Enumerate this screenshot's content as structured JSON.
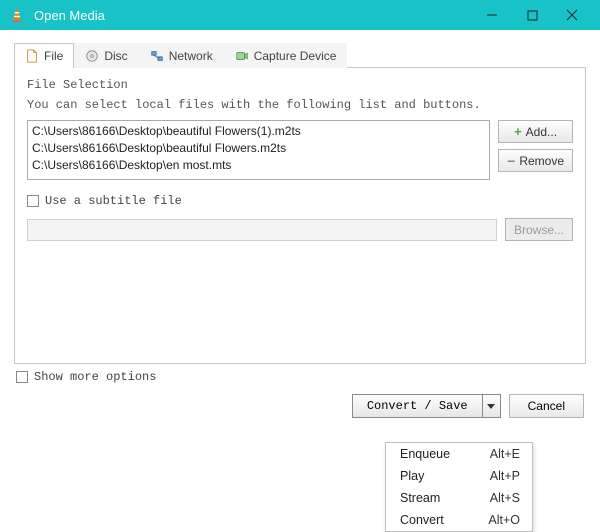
{
  "window": {
    "title": "Open Media"
  },
  "tabs": {
    "file": "File",
    "disc": "Disc",
    "network": "Network",
    "capture": "Capture Device"
  },
  "file_section": {
    "title": "File Selection",
    "hint": "You can select local files with the following list and buttons.",
    "files": [
      "C:\\Users\\86166\\Desktop\\beautiful Flowers(1).m2ts",
      "C:\\Users\\86166\\Desktop\\beautiful Flowers.m2ts",
      "C:\\Users\\86166\\Desktop\\en most.mts"
    ],
    "add_label": "Add...",
    "remove_label": "Remove"
  },
  "subtitle": {
    "use_label": "Use a subtitle file",
    "browse_label": "Browse..."
  },
  "more_options_label": "Show more options",
  "actions": {
    "convert_save": "Convert / Save",
    "cancel": "Cancel"
  },
  "dropdown": [
    {
      "label": "Enqueue",
      "shortcut": "Alt+E"
    },
    {
      "label": "Play",
      "shortcut": "Alt+P"
    },
    {
      "label": "Stream",
      "shortcut": "Alt+S"
    },
    {
      "label": "Convert",
      "shortcut": "Alt+O"
    }
  ]
}
